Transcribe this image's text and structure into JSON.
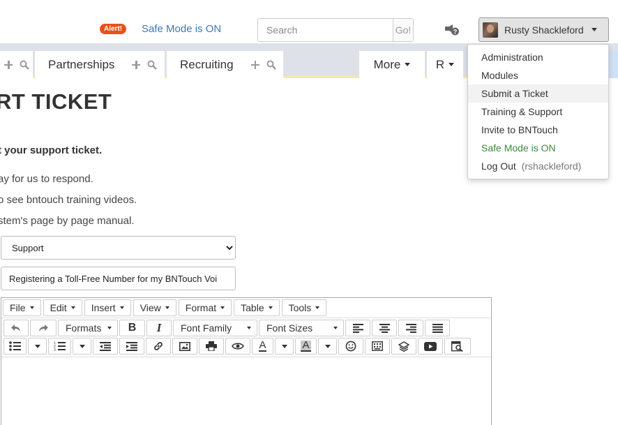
{
  "header": {
    "alert_badge": "Alert!",
    "safe_mode_link": "Safe Mode is ON",
    "search": {
      "placeholder": "Search",
      "go_label": "Go!"
    },
    "user": {
      "name": "Rusty Shackleford"
    }
  },
  "nav": {
    "tabs": [
      {
        "label": "Partnerships"
      },
      {
        "label": "Recruiting"
      }
    ],
    "more_label": "More",
    "r_label": "R"
  },
  "user_menu": {
    "items": [
      {
        "label": "Administration"
      },
      {
        "label": "Modules"
      },
      {
        "label": "Submit a Ticket"
      },
      {
        "label": "Training & Support"
      },
      {
        "label": "Invite to BNTouch"
      },
      {
        "label": "Safe Mode is ON"
      },
      {
        "label": "Log Out",
        "sub": "(rshackleford)"
      }
    ]
  },
  "page": {
    "title": "RT TICKET",
    "intro": "t your support ticket.",
    "lines": [
      "ay for us to respond.",
      "o see bntouch training videos.",
      "stem's page by page manual."
    ],
    "ticket_type": {
      "selected": "Support"
    },
    "subject": {
      "value": "Registering a Toll-Free Number for my BNTouch Voi"
    }
  },
  "editor": {
    "menus": [
      {
        "label": "File"
      },
      {
        "label": "Edit"
      },
      {
        "label": "Insert"
      },
      {
        "label": "View"
      },
      {
        "label": "Format"
      },
      {
        "label": "Table"
      },
      {
        "label": "Tools"
      }
    ],
    "formats_label": "Formats",
    "font_family_label": "Font Family",
    "font_sizes_label": "Font Sizes",
    "bold_label": "B",
    "italic_label": "I",
    "font_color_label": "A",
    "bg_color_label": "A"
  }
}
